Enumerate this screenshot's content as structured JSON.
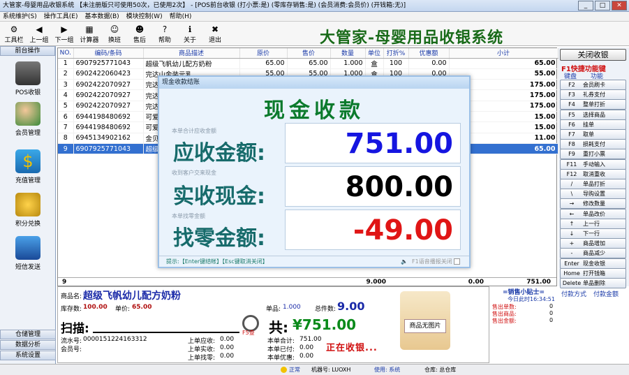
{
  "window": {
    "title": "大管家-母婴用品收银系统 【未注册版只可使用50次，已使用2次】 - [POS前台收银 (打小票:是) (零库存销售:是) (会员消费:会员价) (开钱箱:无)]"
  },
  "menu": [
    "系统维护(S)",
    "操作工具(E)",
    "基本数据(B)",
    "模块控制(W)",
    "帮助(H)"
  ],
  "toolbar": [
    {
      "label": "工具栏",
      "icon": "⚙"
    },
    {
      "label": "上一组",
      "icon": "◀"
    },
    {
      "label": "下一组",
      "icon": "▶"
    },
    {
      "label": "计算器",
      "icon": "▦"
    },
    {
      "label": "换班",
      "icon": "☺"
    },
    {
      "label": "售后",
      "icon": "☻"
    },
    {
      "label": "帮助",
      "icon": "?"
    },
    {
      "label": "关于",
      "icon": "ℹ"
    },
    {
      "label": "退出",
      "icon": "✖"
    }
  ],
  "app_title": "大管家-母婴用品收银系统",
  "left_panel": {
    "header": "前台操作",
    "items": [
      "POS收银",
      "会员管理",
      "充值管理",
      "积分兑换",
      "短信发送"
    ],
    "bottom": [
      "仓储管理",
      "数据分析",
      "系统设置"
    ]
  },
  "table": {
    "columns": [
      "NO.",
      "编码/条码",
      "商品描述",
      "原价",
      "售价",
      "数量",
      "单位",
      "打折%",
      "优惠额",
      "小计"
    ],
    "rows": [
      [
        "1",
        "6907925771043",
        "超级飞帆幼儿配方奶粉",
        "65.00",
        "65.00",
        "1.000",
        "盒",
        "100",
        "0.00",
        "65.00"
      ],
      [
        "2",
        "6902422060423",
        "完达山金装元乳",
        "55.00",
        "55.00",
        "1.000",
        "盒",
        "100",
        "0.00",
        "55.00"
      ],
      [
        "3",
        "6902422070927",
        "完达",
        "",
        "",
        "",
        "",
        "",
        "0.00",
        "175.00"
      ],
      [
        "4",
        "6902422070927",
        "完达",
        "",
        "",
        "",
        "",
        "",
        "0.00",
        "175.00"
      ],
      [
        "5",
        "6902422070927",
        "完达",
        "",
        "",
        "",
        "",
        "",
        "0.00",
        "175.00"
      ],
      [
        "6",
        "6944198480692",
        "可爱",
        "",
        "",
        "",
        "",
        "",
        "0.00",
        "15.00"
      ],
      [
        "7",
        "6944198480692",
        "可爱",
        "",
        "",
        "",
        "",
        "",
        "0.00",
        "15.00"
      ],
      [
        "8",
        "6945134902162",
        "金贝",
        "",
        "",
        "",
        "",
        "",
        "0.00",
        "11.00"
      ],
      [
        "9",
        "6907925771043",
        "超级",
        "",
        "",
        "",
        "",
        "",
        "0.00",
        "65.00"
      ]
    ],
    "footer": {
      "count": "9",
      "qty": "9.000",
      "disc": "0.00",
      "total": "751.00"
    }
  },
  "right_panel": {
    "close_label": "关闭收银",
    "shortcut_title": "F1快捷功能键",
    "keyboard": "键盘",
    "function": "功能",
    "keys": [
      [
        "F2",
        "会员刷卡"
      ],
      [
        "F3",
        "礼券支付"
      ],
      [
        "F4",
        "整单打折"
      ],
      [
        "F5",
        "选择商品"
      ],
      [
        "F6",
        "挂单"
      ],
      [
        "F7",
        "取单"
      ],
      [
        "F8",
        "损耗支付"
      ],
      [
        "F9",
        "重打小票"
      ],
      [
        "F11",
        "手动输入"
      ],
      [
        "F12",
        "取消重收"
      ],
      [
        "/",
        "单品打折"
      ],
      [
        "\\",
        "导购设置"
      ],
      [
        "→",
        "修改数量"
      ],
      [
        "←",
        "单品改价"
      ],
      [
        "↑",
        "上一行"
      ],
      [
        "↓",
        "下一行"
      ],
      [
        "+",
        "商品增加"
      ],
      [
        "-",
        "商品减少"
      ],
      [
        "Enter",
        "现金收银"
      ],
      [
        "Home",
        "打开钱箱"
      ],
      [
        "Delete",
        "单品删除"
      ]
    ],
    "paytype": "付款方式",
    "payamt": "付款金额"
  },
  "info": {
    "product_label": "商品名:",
    "product_name": "超级飞帆幼儿配方奶粉",
    "stock_label": "库存数:",
    "stock": "100.00",
    "price_label": "单价:",
    "price": "65.00",
    "items_label": "单品:",
    "items": "1.000",
    "total_qty_label": "总件数:",
    "total_qty": "9.00",
    "scan_label": "扫描:",
    "f5_label": "F5查",
    "grand_label": "共:",
    "grand": "¥751.00",
    "serial_label": "流水号:",
    "serial": "0000151224163312",
    "member_label": "会员号:",
    "last_recv_label": "上单应收:",
    "last_recv": "0.00",
    "last_paid_label": "上单实收:",
    "last_paid": "0.00",
    "last_change_label": "上单找零:",
    "last_change": "0.00",
    "cur_total_label": "本单合计:",
    "cur_total": "751.00",
    "cur_paid_label": "本单已付:",
    "cur_paid": "0.00",
    "cur_disc_label": "本单优惠:",
    "cur_disc": "0.00",
    "no_image": "商品无图片",
    "collecting": "正在收银..."
  },
  "tips": {
    "title": "=销售小贴士=",
    "time": "今日此时16:34:51",
    "sold_count_label": "售出单数:",
    "sold_count": "0",
    "sold_items_label": "售出商品:",
    "sold_items": "0",
    "sold_amount_label": "售出金额:",
    "sold_amount": "0"
  },
  "status": {
    "state_label": "正常",
    "machine": "机器号: LUOXH",
    "user": "使用: 系统",
    "warehouse": "仓库: 总仓库"
  },
  "modal": {
    "title": "现金收款结账",
    "heading": "现金收款",
    "due_hint": "本单合计应收金额",
    "due_label": "应收金额:",
    "due": "751.00",
    "recv_hint": "收到客户交来现金",
    "recv_label": "实收现金:",
    "recv": "800.00",
    "change_hint": "本单找零金额",
    "change_label": "找零金额:",
    "change": "-49.00",
    "footer": "提示:【Enter键结帐】【Esc键取消关闭】",
    "voice": "F1语音播报关闭"
  },
  "colors": {
    "due": "#1515e0",
    "recv": "#000000",
    "change": "#e01515",
    "heading": "#0b7a2c",
    "label": "#176b6b"
  }
}
